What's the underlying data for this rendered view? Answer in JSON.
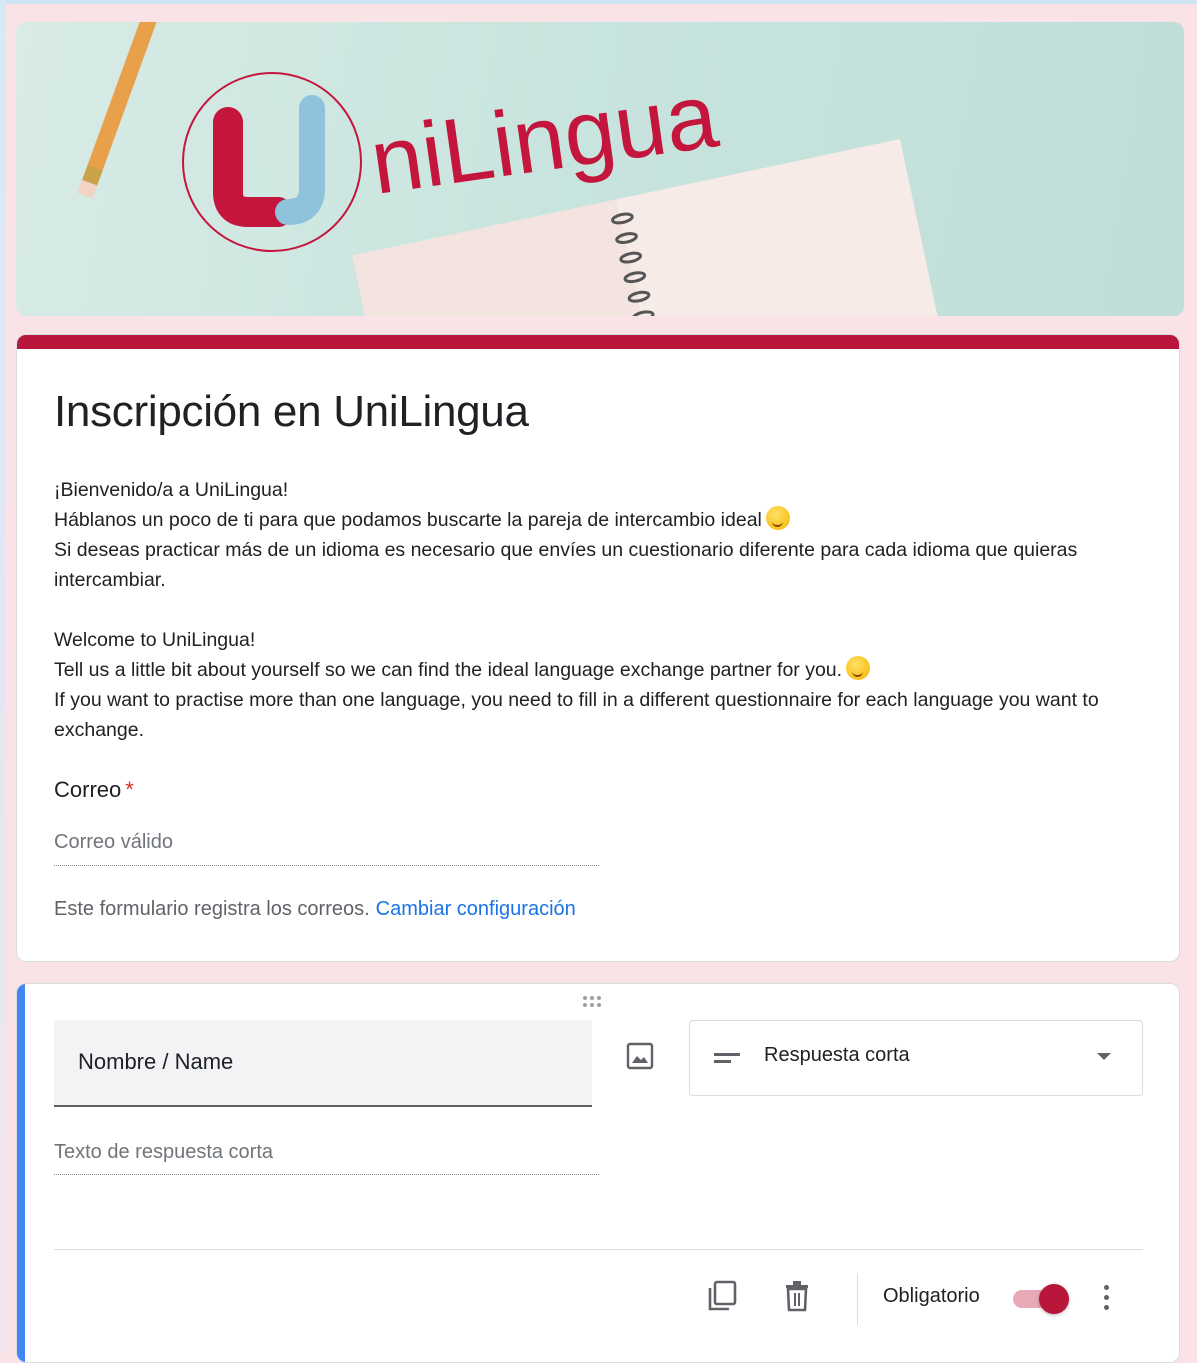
{
  "banner": {
    "logo_text": "UniLingua",
    "logo_colors": {
      "red": "#c4163c",
      "blue": "#8fc3dc"
    }
  },
  "form": {
    "accent_color": "#b8163a",
    "title": "Inscripción en UniLingua",
    "description": [
      "¡Bienvenido/a a UniLingua!",
      "Háblanos un poco de ti para que podamos buscarte la pareja de intercambio ideal",
      "Si deseas practicar más de un idioma es necesario que envíes un cuestionario diferente para cada idioma que quieras intercambiar.",
      "Welcome to UniLingua!",
      "Tell us a little bit about yourself so we can find the ideal language exchange partner for you.",
      "If you want to practise more than one language, you need to fill in a different questionnaire for each language you want to exchange."
    ],
    "email_question": {
      "label": "Correo",
      "required_mark": "*",
      "placeholder": "Correo válido"
    },
    "email_note": "Este formulario registra los correos.",
    "email_note_link": "Cambiar configuración"
  },
  "question": {
    "title": "Nombre / Name",
    "type_label": "Respuesta corta",
    "answer_placeholder": "Texto de respuesta corta",
    "required_label": "Obligatorio",
    "required_on": true,
    "active_accent": "#4285f4",
    "icons": [
      "drag-handle-icon",
      "image-icon",
      "short-text-icon",
      "chevron-down-icon",
      "duplicate-icon",
      "delete-icon",
      "more-vert-icon"
    ]
  }
}
